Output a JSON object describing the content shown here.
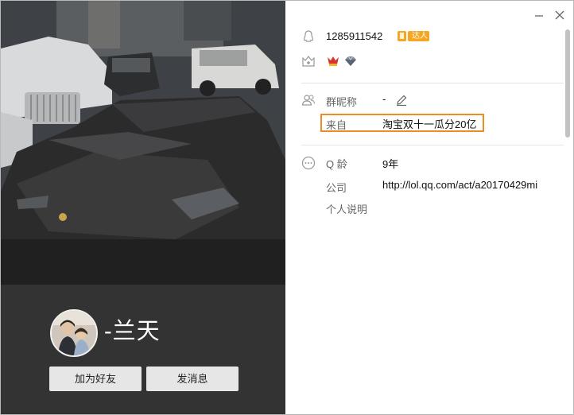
{
  "profile": {
    "nickname": "-兰天",
    "add_friend_label": "加为好友",
    "send_message_label": "发消息"
  },
  "info": {
    "qq_number": "1285911542",
    "vip_badge": "达人",
    "group_nickname_label": "群昵称",
    "group_nickname_value": "-",
    "from_label": "来自",
    "from_value": "淘宝双十一瓜分20亿",
    "qq_age_label": "Q 龄",
    "qq_age_value": "9年",
    "company_label": "公司",
    "company_value": "http://lol.qq.com/act/a20170429mi",
    "personal_desc_label": "个人说明"
  },
  "icons": {
    "minimize": "minimize-icon",
    "close": "close-icon",
    "penguin": "penguin-icon",
    "level": "level-badge-icon",
    "group": "group-members-icon",
    "more": "more-icon",
    "edit": "edit-pencil-icon"
  },
  "colors": {
    "accent_highlight": "#f08a24",
    "left_panel_bg": "#333333",
    "button_bg": "#e6e6e6",
    "badge_orange": "#f5a623"
  }
}
